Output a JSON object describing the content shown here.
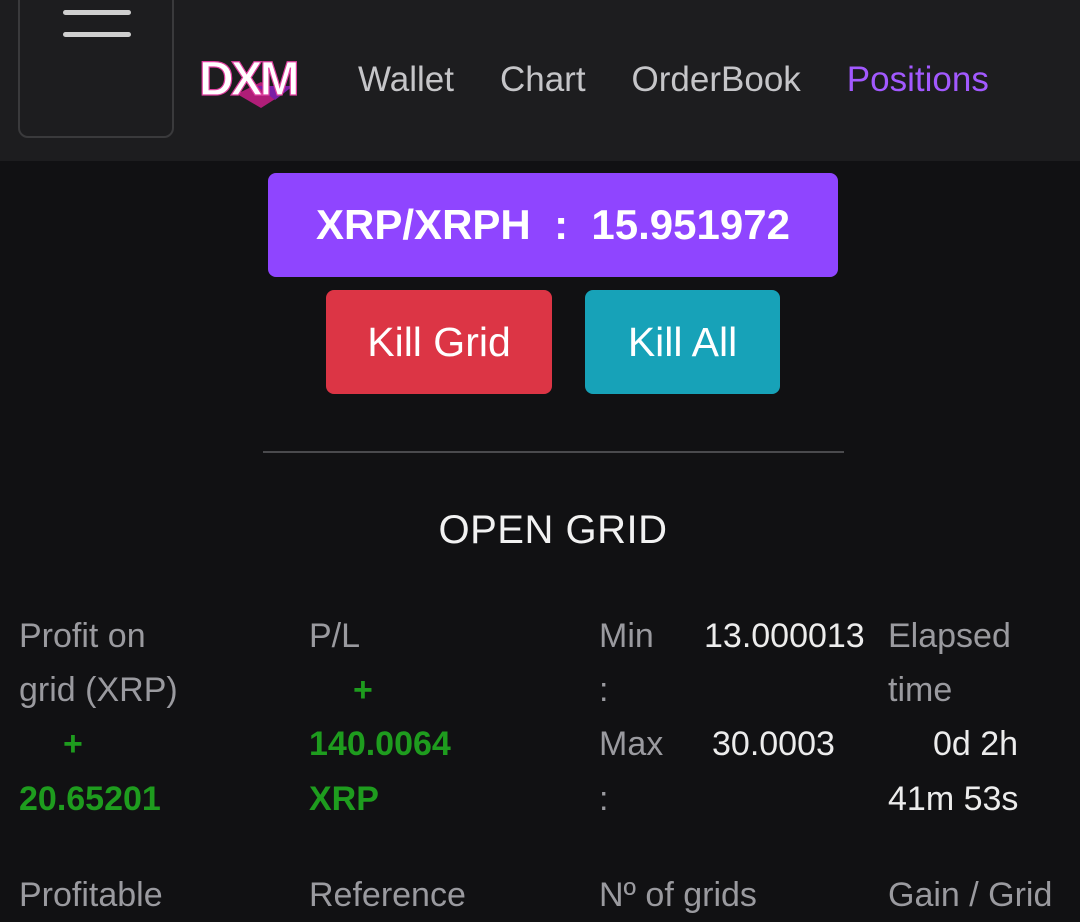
{
  "header": {
    "logo_text": "DXM",
    "nav": [
      {
        "label": "Wallet",
        "active": false
      },
      {
        "label": "Chart",
        "active": false
      },
      {
        "label": "OrderBook",
        "active": false
      },
      {
        "label": "Positions",
        "active": true
      }
    ]
  },
  "pair_display": "XRP/XRPH  :  15.951972",
  "buttons": {
    "kill_grid": "Kill Grid",
    "kill_all": "Kill All"
  },
  "section_title": "OPEN GRID",
  "stats": {
    "profit_label_1": "Profit on",
    "profit_label_2": "grid (XRP)",
    "profit_sign": "+",
    "profit_value": "20.65201",
    "pl_label": "P/L",
    "pl_sign": "+",
    "pl_value": "140.0064",
    "pl_unit": "XRP",
    "min_label": "Min",
    "min_colon": ":",
    "min_value": "13.000013",
    "max_label": "Max",
    "max_colon": ":",
    "max_value": "30.0003",
    "elapsed_label_1": "Elapsed",
    "elapsed_label_2": "time",
    "elapsed_value_1": "0d 2h",
    "elapsed_value_2": "41m 53s"
  },
  "next_row_labels": [
    "Profitable",
    "Reference",
    "Nº of grids",
    "Gain / Grid"
  ],
  "colors": {
    "accent": "#a259ff",
    "pair_bg": "#8f45ff",
    "kill_grid_bg": "#dc3545",
    "kill_all_bg": "#17a2b8",
    "positive": "#1e9c1e"
  }
}
